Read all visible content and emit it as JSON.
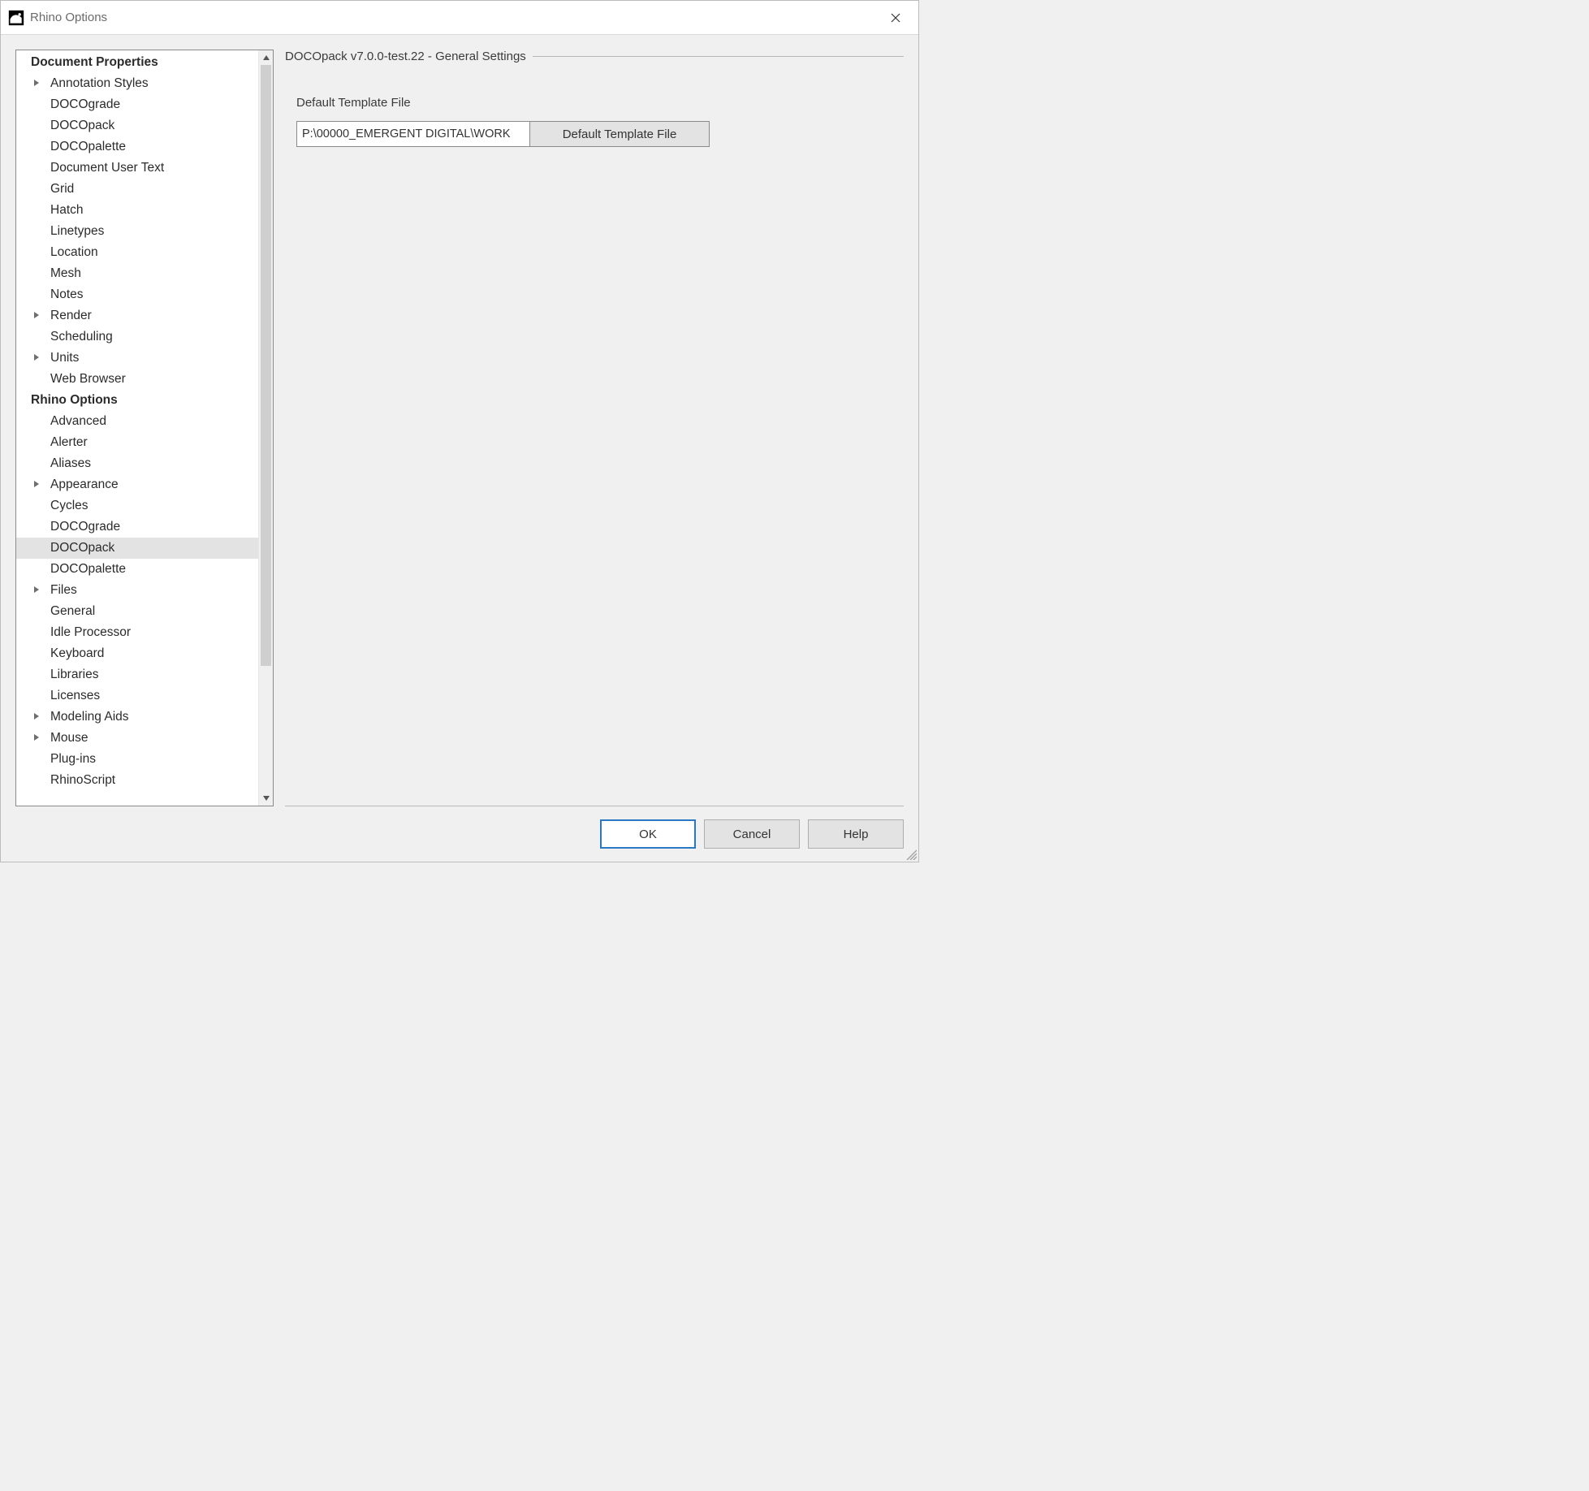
{
  "window": {
    "title": "Rhino Options"
  },
  "tree": {
    "sections": [
      {
        "label": "Document Properties",
        "header": true,
        "items": [
          {
            "label": "Annotation Styles",
            "expandable": true
          },
          {
            "label": "DOCOgrade"
          },
          {
            "label": "DOCOpack"
          },
          {
            "label": "DOCOpalette"
          },
          {
            "label": "Document User Text"
          },
          {
            "label": "Grid"
          },
          {
            "label": "Hatch"
          },
          {
            "label": "Linetypes"
          },
          {
            "label": "Location"
          },
          {
            "label": "Mesh"
          },
          {
            "label": "Notes"
          },
          {
            "label": "Render",
            "expandable": true
          },
          {
            "label": "Scheduling"
          },
          {
            "label": "Units",
            "expandable": true
          },
          {
            "label": "Web Browser"
          }
        ]
      },
      {
        "label": "Rhino Options",
        "header": true,
        "items": [
          {
            "label": "Advanced"
          },
          {
            "label": "Alerter"
          },
          {
            "label": "Aliases"
          },
          {
            "label": "Appearance",
            "expandable": true
          },
          {
            "label": "Cycles"
          },
          {
            "label": "DOCOgrade"
          },
          {
            "label": "DOCOpack",
            "selected": true
          },
          {
            "label": "DOCOpalette"
          },
          {
            "label": "Files",
            "expandable": true
          },
          {
            "label": "General"
          },
          {
            "label": "Idle Processor"
          },
          {
            "label": "Keyboard"
          },
          {
            "label": "Libraries"
          },
          {
            "label": "Licenses"
          },
          {
            "label": "Modeling Aids",
            "expandable": true
          },
          {
            "label": "Mouse",
            "expandable": true
          },
          {
            "label": "Plug-ins"
          },
          {
            "label": "RhinoScript"
          }
        ]
      }
    ]
  },
  "content": {
    "section_title": "DOCOpack v7.0.0-test.22 - General Settings",
    "template_label": "Default Template File",
    "template_path": "P:\\00000_EMERGENT DIGITAL\\WORK",
    "browse_button": "Default Template File"
  },
  "footer": {
    "ok": "OK",
    "cancel": "Cancel",
    "help": "Help"
  }
}
